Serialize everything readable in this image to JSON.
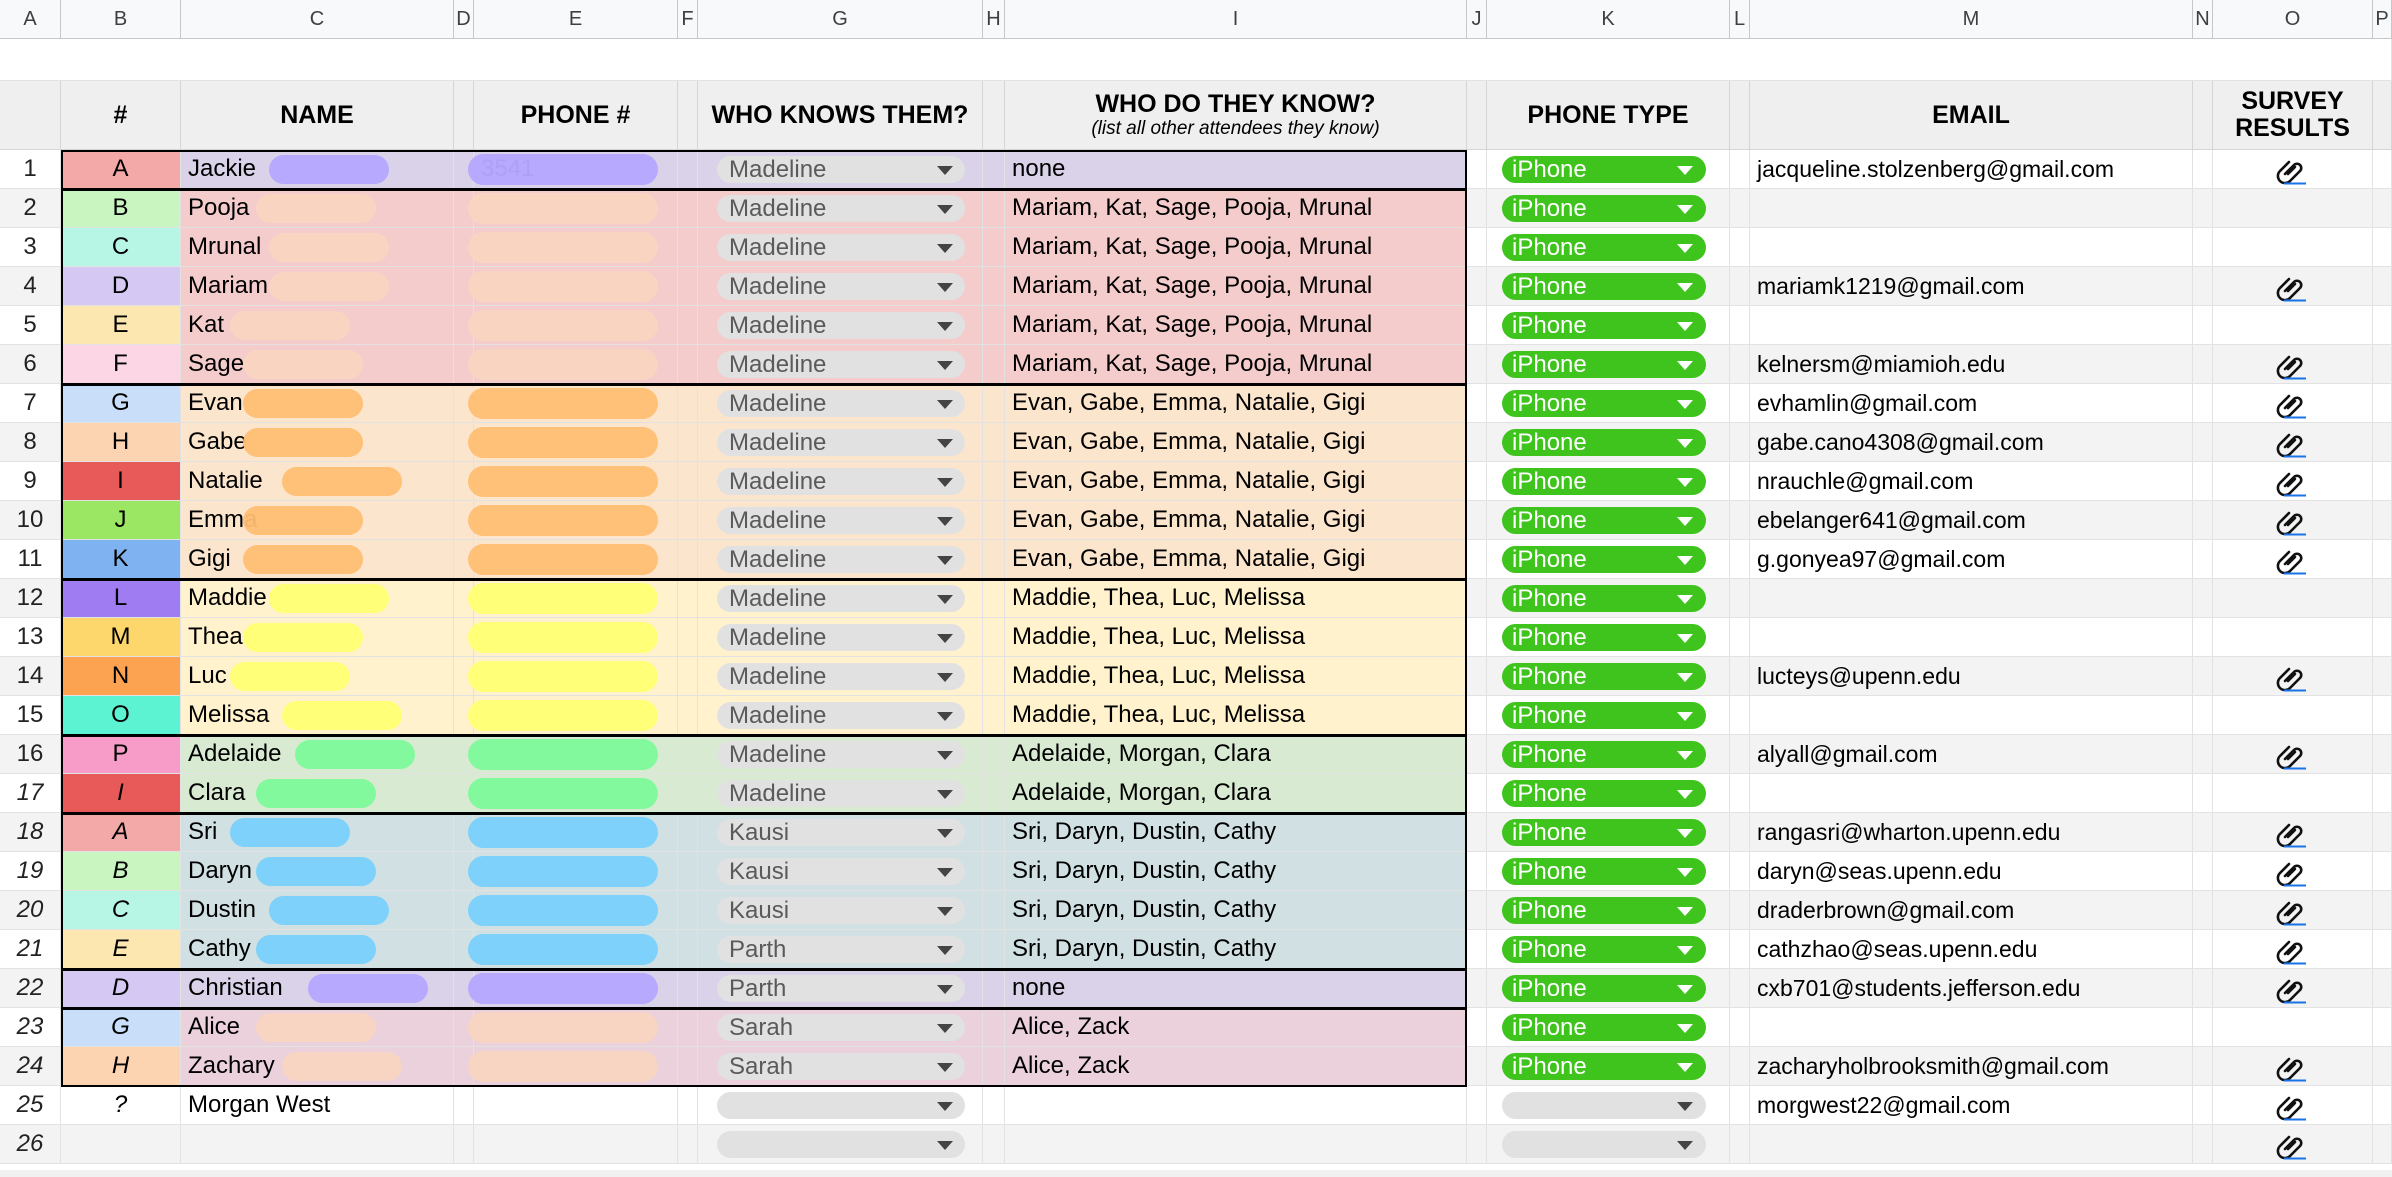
{
  "columns": [
    "A",
    "B",
    "C",
    "D",
    "E",
    "F",
    "G",
    "H",
    "I",
    "J",
    "K",
    "L",
    "M",
    "N",
    "O",
    "P"
  ],
  "headers": {
    "num": "#",
    "name": "NAME",
    "phone": "PHONE #",
    "who_knows": "WHO KNOWS THEM?",
    "who_do_they_know": "WHO DO THEY KNOW?",
    "who_do_they_know_sub": "(list all other attendees they know)",
    "phone_type": "PHONE TYPE",
    "email": "EMAIL",
    "survey_results_1": "SURVEY",
    "survey_results_2": "RESULTS"
  },
  "colors": {
    "group_red": "#f4cccc",
    "group_orange": "#fce5cd",
    "group_yellow": "#fff2cc",
    "group_green": "#d9ead3",
    "group_blue": "#d0e0e3",
    "group_purple": "#d9d2e9",
    "group_pink": "#ead1dc",
    "phone_chip": "#3fc41d",
    "chip_gray": "#e1e1e1"
  },
  "rows": [
    {
      "n": "1",
      "letter": "A",
      "italic": false,
      "letter_bg": "#f4a9a9",
      "name": "Jackie",
      "phone": "3541",
      "who": "Madeline",
      "know": "none",
      "type": "iPhone",
      "email": "jacqueline.stolzenberg@gmail.com",
      "survey": true,
      "group_bg": "#d9d2e9",
      "blot": "#b4a7ff"
    },
    {
      "n": "2",
      "letter": "B",
      "italic": false,
      "letter_bg": "#c8f5c0",
      "name": "Pooja",
      "phone": "",
      "who": "Madeline",
      "know": "Mariam, Kat, Sage, Pooja, Mrunal",
      "type": "iPhone",
      "email": "",
      "survey": false,
      "group_bg": "#f4cccc",
      "blot": "#f9d5c0"
    },
    {
      "n": "3",
      "letter": "C",
      "italic": false,
      "letter_bg": "#b7f5e5",
      "name": "Mrunal",
      "phone": "",
      "who": "Madeline",
      "know": "Mariam, Kat, Sage, Pooja, Mrunal",
      "type": "iPhone",
      "email": "",
      "survey": false,
      "group_bg": "#f4cccc",
      "blot": "#f9d5c0"
    },
    {
      "n": "4",
      "letter": "D",
      "italic": false,
      "letter_bg": "#d5c8f2",
      "name": "Mariam",
      "phone": "",
      "who": "Madeline",
      "know": "Mariam, Kat, Sage, Pooja, Mrunal",
      "type": "iPhone",
      "email": "mariamk1219@gmail.com",
      "survey": true,
      "group_bg": "#f4cccc",
      "blot": "#f9d5c0"
    },
    {
      "n": "5",
      "letter": "E",
      "italic": false,
      "letter_bg": "#fde7b0",
      "name": "Kat",
      "phone": "",
      "who": "Madeline",
      "know": "Mariam, Kat, Sage, Pooja, Mrunal",
      "type": "iPhone",
      "email": "",
      "survey": false,
      "group_bg": "#f4cccc",
      "blot": "#f9d5c0"
    },
    {
      "n": "6",
      "letter": "F",
      "italic": false,
      "letter_bg": "#fcd6e5",
      "name": "Sage",
      "phone": "",
      "who": "Madeline",
      "know": "Mariam, Kat, Sage, Pooja, Mrunal",
      "type": "iPhone",
      "email": "kelnersm@miamioh.edu",
      "survey": true,
      "group_bg": "#f4cccc",
      "blot": "#f9d5c0"
    },
    {
      "n": "7",
      "letter": "G",
      "italic": false,
      "letter_bg": "#c9def9",
      "name": "Evan",
      "phone": "",
      "who": "Madeline",
      "know": "Evan, Gabe, Emma, Natalie, Gigi",
      "type": "iPhone",
      "email": "evhamlin@gmail.com",
      "survey": true,
      "group_bg": "#fce5cd",
      "blot": "#ffbe73"
    },
    {
      "n": "8",
      "letter": "H",
      "italic": false,
      "letter_bg": "#fcd4b2",
      "name": "Gabe",
      "phone": "",
      "who": "Madeline",
      "know": "Evan, Gabe, Emma, Natalie, Gigi",
      "type": "iPhone",
      "email": "gabe.cano4308@gmail.com",
      "survey": true,
      "group_bg": "#fce5cd",
      "blot": "#ffbe73"
    },
    {
      "n": "9",
      "letter": "I",
      "italic": false,
      "letter_bg": "#e85a5a",
      "name": "Natalie",
      "phone": "",
      "who": "Madeline",
      "know": "Evan, Gabe, Emma, Natalie, Gigi",
      "type": "iPhone",
      "email": "nrauchle@gmail.com",
      "survey": true,
      "group_bg": "#fce5cd",
      "blot": "#ffbe73"
    },
    {
      "n": "10",
      "letter": "J",
      "italic": false,
      "letter_bg": "#9be764",
      "name": "Emma",
      "phone": "",
      "who": "Madeline",
      "know": "Evan, Gabe, Emma, Natalie, Gigi",
      "type": "iPhone",
      "email": "ebelanger641@gmail.com",
      "survey": true,
      "group_bg": "#fce5cd",
      "blot": "#ffbe73"
    },
    {
      "n": "11",
      "letter": "K",
      "italic": false,
      "letter_bg": "#7fb2f0",
      "name": "Gigi",
      "phone": "",
      "who": "Madeline",
      "know": "Evan, Gabe, Emma, Natalie, Gigi",
      "type": "iPhone",
      "email": "g.gonyea97@gmail.com",
      "survey": true,
      "group_bg": "#fce5cd",
      "blot": "#ffbe73"
    },
    {
      "n": "12",
      "letter": "L",
      "italic": false,
      "letter_bg": "#9f7cf2",
      "name": "Maddie",
      "phone": "",
      "who": "Madeline",
      "know": "Maddie, Thea, Luc, Melissa",
      "type": "iPhone",
      "email": "",
      "survey": false,
      "group_bg": "#fff2cc",
      "blot": "#ffff73"
    },
    {
      "n": "13",
      "letter": "M",
      "italic": false,
      "letter_bg": "#fdd66c",
      "name": "Thea",
      "phone": "",
      "who": "Madeline",
      "know": "Maddie, Thea, Luc, Melissa",
      "type": "iPhone",
      "email": "",
      "survey": false,
      "group_bg": "#fff2cc",
      "blot": "#ffff73"
    },
    {
      "n": "14",
      "letter": "N",
      "italic": false,
      "letter_bg": "#fba350",
      "name": "Luc",
      "phone": "",
      "who": "Madeline",
      "know": "Maddie, Thea, Luc, Melissa",
      "type": "iPhone",
      "email": "lucteys@upenn.edu",
      "survey": true,
      "group_bg": "#fff2cc",
      "blot": "#ffff73"
    },
    {
      "n": "15",
      "letter": "O",
      "italic": false,
      "letter_bg": "#5cf3d2",
      "name": "Melissa",
      "phone": "",
      "who": "Madeline",
      "know": "Maddie, Thea, Luc, Melissa",
      "type": "iPhone",
      "email": "",
      "survey": false,
      "group_bg": "#fff2cc",
      "blot": "#ffff73"
    },
    {
      "n": "16",
      "letter": "P",
      "italic": false,
      "letter_bg": "#f79cc9",
      "name": "Adelaide",
      "phone": "",
      "who": "Madeline",
      "know": "Adelaide, Morgan, Clara",
      "type": "iPhone",
      "email": "alyall@gmail.com",
      "survey": true,
      "group_bg": "#d9ead3",
      "blot": "#7dfa9a"
    },
    {
      "n": "17",
      "letter": "I",
      "italic": true,
      "letter_bg": "#e85a5a",
      "name": "Clara",
      "phone": "",
      "who": "Madeline",
      "know": "Adelaide, Morgan, Clara",
      "type": "iPhone",
      "email": "",
      "survey": false,
      "group_bg": "#d9ead3",
      "blot": "#7dfa9a"
    },
    {
      "n": "18",
      "letter": "A",
      "italic": true,
      "letter_bg": "#f4a9a9",
      "name": "Sri",
      "phone": "",
      "who": "Kausi",
      "know": "Sri, Daryn, Dustin, Cathy",
      "type": "iPhone",
      "email": "rangasri@wharton.upenn.edu",
      "survey": true,
      "group_bg": "#d0e0e3",
      "blot": "#78d0fc"
    },
    {
      "n": "19",
      "letter": "B",
      "italic": true,
      "letter_bg": "#c8f5c0",
      "name": "Daryn",
      "phone": "",
      "who": "Kausi",
      "know": "Sri, Daryn, Dustin, Cathy",
      "type": "iPhone",
      "email": "daryn@seas.upenn.edu",
      "survey": true,
      "group_bg": "#d0e0e3",
      "blot": "#78d0fc"
    },
    {
      "n": "20",
      "letter": "C",
      "italic": true,
      "letter_bg": "#b7f5e5",
      "name": "Dustin",
      "phone": "",
      "who": "Kausi",
      "know": "Sri, Daryn, Dustin, Cathy",
      "type": "iPhone",
      "email": "draderbrown@gmail.com",
      "survey": true,
      "group_bg": "#d0e0e3",
      "blot": "#78d0fc"
    },
    {
      "n": "21",
      "letter": "E",
      "italic": true,
      "letter_bg": "#fde7b0",
      "name": "Cathy",
      "phone": "",
      "who": "Parth",
      "know": "Sri, Daryn, Dustin, Cathy",
      "type": "iPhone",
      "email": "cathzhao@seas.upenn.edu",
      "survey": true,
      "group_bg": "#d0e0e3",
      "blot": "#78d0fc"
    },
    {
      "n": "22",
      "letter": "D",
      "italic": true,
      "letter_bg": "#d5c8f2",
      "name": "Christian",
      "phone": "",
      "who": "Parth",
      "know": "none",
      "type": "iPhone",
      "email": "cxb701@students.jefferson.edu",
      "survey": true,
      "group_bg": "#d9d2e9",
      "blot": "#b4a7ff"
    },
    {
      "n": "23",
      "letter": "G",
      "italic": true,
      "letter_bg": "#c9def9",
      "name": "Alice",
      "phone": "",
      "who": "Sarah",
      "know": "Alice, Zack",
      "type": "iPhone",
      "email": "",
      "survey": false,
      "group_bg": "#ead1dc",
      "blot": "#f9d5c0"
    },
    {
      "n": "24",
      "letter": "H",
      "italic": true,
      "letter_bg": "#fcd4b2",
      "name": "Zachary",
      "phone": "",
      "who": "Sarah",
      "know": "Alice, Zack",
      "type": "iPhone",
      "email": "zacharyholbrooksmith@gmail.com",
      "survey": true,
      "group_bg": "#ead1dc",
      "blot": "#f9d5c0"
    },
    {
      "n": "25",
      "letter": "?",
      "italic": true,
      "letter_bg": "",
      "name": "Morgan West",
      "phone": "",
      "who": "",
      "know": "",
      "type": "",
      "email": "morgwest22@gmail.com",
      "survey": true,
      "group_bg": "",
      "blot": ""
    },
    {
      "n": "26",
      "letter": "",
      "italic": true,
      "letter_bg": "",
      "name": "",
      "phone": "",
      "who": "",
      "know": "",
      "type": "",
      "email": "",
      "survey": true,
      "group_bg": "",
      "blot": ""
    }
  ]
}
